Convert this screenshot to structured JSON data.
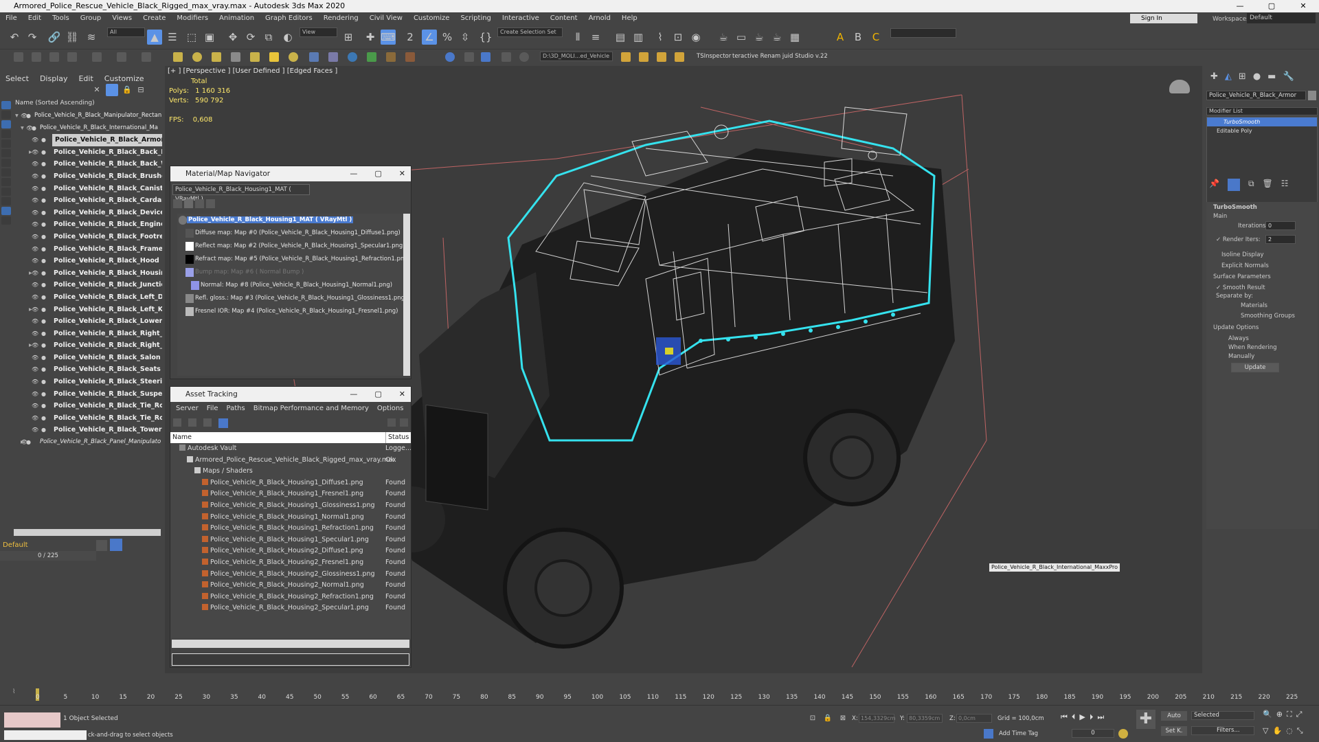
{
  "window": {
    "title": "Armored_Police_Rescue_Vehicle_Black_Rigged_max_vray.max - Autodesk 3ds Max 2020",
    "buttons": [
      "—",
      "▢",
      "✕"
    ]
  },
  "menu": [
    "File",
    "Edit",
    "Tools",
    "Group",
    "Views",
    "Create",
    "Modifiers",
    "Animation",
    "Graph Editors",
    "Rendering",
    "Civil View",
    "Customize",
    "Scripting",
    "Interactive",
    "Content",
    "Arnold",
    "Help"
  ],
  "signin": "Sign In",
  "workspaces_label": "Workspaces:",
  "workspace_value": "Default",
  "toolbar": {
    "filter_all": "All",
    "view": "View",
    "create_selection_set": "Create Selection Set",
    "named_object": "D:\\3D_MOLI...ed_Vehicle",
    "tsinspector": "TSInspector",
    "renamer": "teractive Renam juid Studio v.22"
  },
  "scene_explorer": {
    "tabs": [
      "Select",
      "Display",
      "Edit",
      "Customize"
    ],
    "header": "Name (Sorted Ascending)",
    "items": [
      {
        "label": "Police_Vehicle_R_Black_Manipulator_Rectan",
        "bold": false,
        "expand": "▾"
      },
      {
        "label": "Police_Vehicle_R_Black_International_Ma",
        "bold": false,
        "expand": "▾"
      },
      {
        "label": "Police_Vehicle_R_Black_Armor",
        "bold": true,
        "selected": true
      },
      {
        "label": "Police_Vehicle_R_Black_Back_Doo",
        "bold": true,
        "expand": "▸"
      },
      {
        "label": "Police_Vehicle_R_Black_Back_Wh",
        "bold": true
      },
      {
        "label": "Police_Vehicle_R_Black_Brushes",
        "bold": true
      },
      {
        "label": "Police_Vehicle_R_Black_Canisters",
        "bold": true
      },
      {
        "label": "Police_Vehicle_R_Black_Cardans",
        "bold": true
      },
      {
        "label": "Police_Vehicle_R_Black_Devices",
        "bold": true
      },
      {
        "label": "Police_Vehicle_R_Black_Engine",
        "bold": true
      },
      {
        "label": "Police_Vehicle_R_Black_Footrests",
        "bold": true
      },
      {
        "label": "Police_Vehicle_R_Black_Frame",
        "bold": true
      },
      {
        "label": "Police_Vehicle_R_Black_Hood",
        "bold": true
      },
      {
        "label": "Police_Vehicle_R_Black_Housing",
        "bold": true,
        "expand": "▸"
      },
      {
        "label": "Police_Vehicle_R_Black_Junction_",
        "bold": true
      },
      {
        "label": "Police_Vehicle_R_Black_Left_Doo",
        "bold": true
      },
      {
        "label": "Police_Vehicle_R_Black_Left_Knu",
        "bold": true,
        "expand": "▸"
      },
      {
        "label": "Police_Vehicle_R_Black_Lower_Bo",
        "bold": true
      },
      {
        "label": "Police_Vehicle_R_Black_Right_Do",
        "bold": true
      },
      {
        "label": "Police_Vehicle_R_Black_Right_Kn",
        "bold": true,
        "expand": "▸"
      },
      {
        "label": "Police_Vehicle_R_Black_Salon",
        "bold": true
      },
      {
        "label": "Police_Vehicle_R_Black_Seats",
        "bold": true
      },
      {
        "label": "Police_Vehicle_R_Black_Steering_",
        "bold": true
      },
      {
        "label": "Police_Vehicle_R_Black_Suspensi",
        "bold": true
      },
      {
        "label": "Police_Vehicle_R_Black_Tie_Rod_",
        "bold": true
      },
      {
        "label": "Police_Vehicle_R_Black_Tie_Rod_",
        "bold": true
      },
      {
        "label": "Police_Vehicle_R_Black_Tower",
        "bold": true
      },
      {
        "label": "Police_Vehicle_R_Black_Panel_Manipulato",
        "bold": false,
        "expand": "▸"
      }
    ],
    "layer": "Default",
    "frame_counter": "0 / 225"
  },
  "viewport": {
    "label": "[+ ] [Perspective ] [User Defined ] [Edged Faces ]",
    "stats_total": "Total",
    "polys_label": "Polys:",
    "polys_value": "1 160 316",
    "verts_label": "Verts:",
    "verts_value": "590 792",
    "fps_label": "FPS:",
    "fps_value": "0,608",
    "tooltip": "Police_Vehicle_R_Black_International_MaxxPro"
  },
  "material_navigator": {
    "title": "Material/Map Navigator",
    "material_name": "Police_Vehicle_R_Black_Housing1_MAT  ( VRayMtl )",
    "header": "Police_Vehicle_R_Black_Housing1_MAT  ( VRayMtl )",
    "maps": [
      {
        "label": "Diffuse map: Map #0 (Police_Vehicle_R_Black_Housing1_Diffuse1.png)",
        "swatch": "#555",
        "dim": false
      },
      {
        "label": "Reflect map: Map #2 (Police_Vehicle_R_Black_Housing1_Specular1.png)",
        "swatch": "#fff",
        "dim": false
      },
      {
        "label": "Refract map: Map #5 (Police_Vehicle_R_Black_Housing1_Refraction1.png)",
        "swatch": "#000",
        "dim": false
      },
      {
        "label": "Bump map: Map #6  ( Normal Bump )",
        "swatch": "#9aa0e8",
        "dim": true
      },
      {
        "label": "Normal: Map #8 (Police_Vehicle_R_Black_Housing1_Normal1.png)",
        "swatch": "#8f93e6",
        "dim": false
      },
      {
        "label": "Refl. gloss.: Map #3 (Police_Vehicle_R_Black_Housing1_Glossiness1.png)",
        "swatch": "#888",
        "dim": false
      },
      {
        "label": "Fresnel IOR: Map #4 (Police_Vehicle_R_Black_Housing1_Fresnel1.png)",
        "swatch": "#bbb",
        "dim": false
      }
    ]
  },
  "asset_tracking": {
    "title": "Asset Tracking",
    "menu": [
      "Server",
      "File",
      "Paths",
      "Bitmap Performance and Memory",
      "Options"
    ],
    "col_name": "Name",
    "col_status": "Status",
    "rows": [
      {
        "name": "Autodesk Vault",
        "status": "Logge...",
        "indent": 1,
        "file": false
      },
      {
        "name": "Armored_Police_Rescue_Vehicle_Black_Rigged_max_vray.max",
        "status": "Ok",
        "indent": 2,
        "file": false
      },
      {
        "name": "Maps / Shaders",
        "status": "",
        "indent": 3,
        "file": false
      },
      {
        "name": "Police_Vehicle_R_Black_Housing1_Diffuse1.png",
        "status": "Found",
        "indent": 4,
        "file": true
      },
      {
        "name": "Police_Vehicle_R_Black_Housing1_Fresnel1.png",
        "status": "Found",
        "indent": 4,
        "file": true
      },
      {
        "name": "Police_Vehicle_R_Black_Housing1_Glossiness1.png",
        "status": "Found",
        "indent": 4,
        "file": true
      },
      {
        "name": "Police_Vehicle_R_Black_Housing1_Normal1.png",
        "status": "Found",
        "indent": 4,
        "file": true
      },
      {
        "name": "Police_Vehicle_R_Black_Housing1_Refraction1.png",
        "status": "Found",
        "indent": 4,
        "file": true
      },
      {
        "name": "Police_Vehicle_R_Black_Housing1_Specular1.png",
        "status": "Found",
        "indent": 4,
        "file": true
      },
      {
        "name": "Police_Vehicle_R_Black_Housing2_Diffuse1.png",
        "status": "Found",
        "indent": 4,
        "file": true
      },
      {
        "name": "Police_Vehicle_R_Black_Housing2_Fresnel1.png",
        "status": "Found",
        "indent": 4,
        "file": true
      },
      {
        "name": "Police_Vehicle_R_Black_Housing2_Glossiness1.png",
        "status": "Found",
        "indent": 4,
        "file": true
      },
      {
        "name": "Police_Vehicle_R_Black_Housing2_Normal1.png",
        "status": "Found",
        "indent": 4,
        "file": true
      },
      {
        "name": "Police_Vehicle_R_Black_Housing2_Refraction1.png",
        "status": "Found",
        "indent": 4,
        "file": true
      },
      {
        "name": "Police_Vehicle_R_Black_Housing2_Specular1.png",
        "status": "Found",
        "indent": 4,
        "file": true
      }
    ]
  },
  "command_panel": {
    "object_name": "Police_Vehicle_R_Black_Armor",
    "modifier_list": "Modifier List",
    "stack": [
      {
        "label": "TurboSmooth",
        "active": true
      },
      {
        "label": "Editable Poly",
        "active": false
      }
    ],
    "rollout_title": "TurboSmooth",
    "main": "Main",
    "iterations_label": "Iterations:",
    "iterations_value": "0",
    "render_iters_label": "Render Iters:",
    "render_iters_value": "2",
    "isoline": "Isoline Display",
    "explicit_normals": "Explicit Normals",
    "surface_params": "Surface Parameters",
    "smooth_result": "Smooth Result",
    "separate_by": "Separate by:",
    "materials": "Materials",
    "smoothing_groups": "Smoothing Groups",
    "update_options": "Update Options",
    "always": "Always",
    "when_rendering": "When Rendering",
    "manually": "Manually",
    "update_button": "Update"
  },
  "timeline": {
    "ticks": [
      "0",
      "5",
      "10",
      "15",
      "20",
      "25",
      "30",
      "35",
      "40",
      "45",
      "50",
      "55",
      "60",
      "65",
      "70",
      "75",
      "80",
      "85",
      "90",
      "95",
      "100",
      "105",
      "110",
      "115",
      "120",
      "125",
      "130",
      "135",
      "140",
      "145",
      "150",
      "155",
      "160",
      "165",
      "170",
      "175",
      "180",
      "185",
      "190",
      "195",
      "200",
      "205",
      "210",
      "215",
      "220",
      "225"
    ]
  },
  "status": {
    "selected_text": "1 Object Selected",
    "prompt": "ck-and-drag to select objects",
    "x_label": "X:",
    "x_value": "154,3329cm",
    "y_label": "Y:",
    "y_value": "80,3359cm",
    "z_label": "Z:",
    "z_value": "0,0cm",
    "grid": "Grid = 100,0cm",
    "add_time_tag": "Add Time Tag",
    "auto": "Auto",
    "selected_dd": "Selected",
    "set_key": "Set K.",
    "filters": "Filters...",
    "frame": "0"
  }
}
